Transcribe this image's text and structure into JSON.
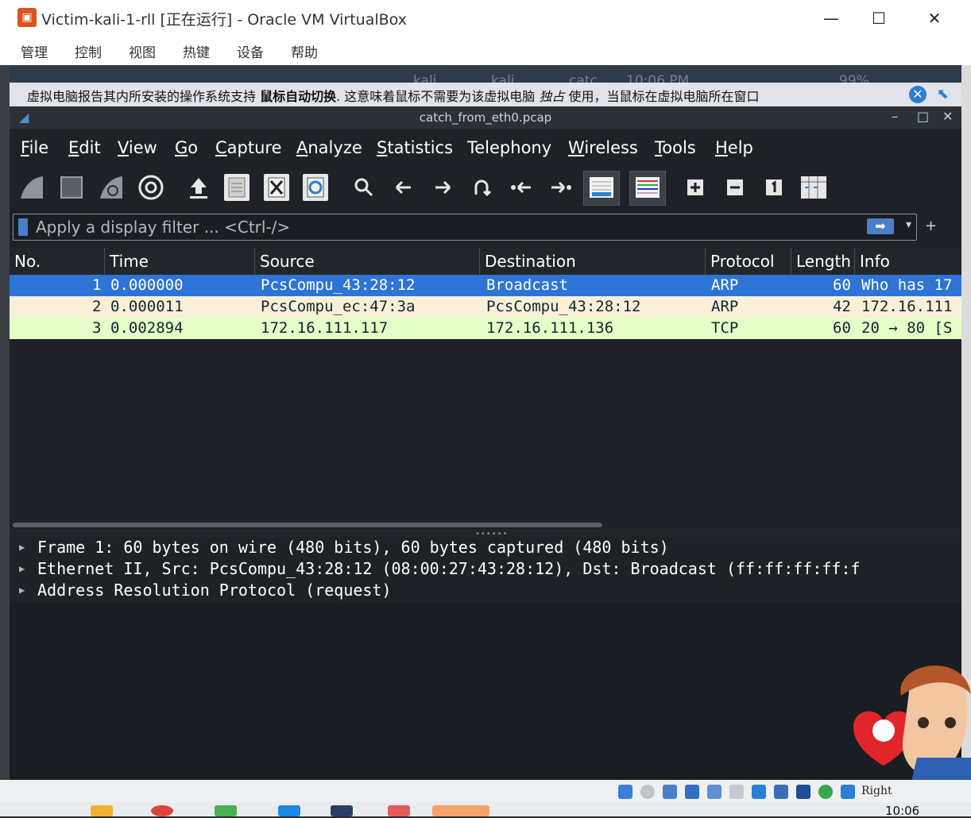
{
  "host_window": {
    "title": "Victim-kali-1-rll [正在运行] - Oracle VM VirtualBox",
    "minimize": "—",
    "maximize": "☐",
    "close": "✕"
  },
  "host_menu": [
    "管理",
    "控制",
    "视图",
    "热键",
    "设备",
    "帮助"
  ],
  "guest_panel": {
    "items": [
      "kali",
      "kali",
      "catc...",
      "10:06 PM",
      "99%"
    ]
  },
  "notice": {
    "text_before": "虚拟电脑报告其内所安装的操作系统支持",
    "bold": "鼠标自动切换",
    "text_mid": ". 这意味着鼠标不需要为该虚拟电脑",
    "italic": "独占",
    "text_after": "使用，当鼠标在虚拟电脑所在窗口"
  },
  "wireshark": {
    "title": "catch_from_eth0.pcap",
    "controls": [
      "–",
      "□",
      "✕"
    ],
    "menu": [
      {
        "u": "F",
        "rest": "ile"
      },
      {
        "u": "E",
        "rest": "dit"
      },
      {
        "u": "V",
        "rest": "iew"
      },
      {
        "u": "G",
        "rest": "o"
      },
      {
        "u": "C",
        "rest": "apture"
      },
      {
        "u": "A",
        "rest": "nalyze"
      },
      {
        "u": "S",
        "rest": "tatistics"
      },
      {
        "u": "",
        "rest": "Telephony"
      },
      {
        "u": "W",
        "rest": "ireless"
      },
      {
        "u": "T",
        "rest": "ools"
      },
      {
        "u": "H",
        "rest": "elp"
      }
    ],
    "filter": {
      "placeholder": "Apply a display filter ... <Ctrl-/>",
      "value": ""
    },
    "columns": [
      "No.",
      "Time",
      "Source",
      "Destination",
      "Protocol",
      "Length",
      "Info"
    ],
    "packets": [
      {
        "no": "1",
        "time": "0.000000",
        "source": "PcsCompu_43:28:12",
        "destination": "Broadcast",
        "protocol": "ARP",
        "length": "60",
        "info": "Who has 17"
      },
      {
        "no": "2",
        "time": "0.000011",
        "source": "PcsCompu_ec:47:3a",
        "destination": "PcsCompu_43:28:12",
        "protocol": "ARP",
        "length": "42",
        "info": "172.16.111"
      },
      {
        "no": "3",
        "time": "0.002894",
        "source": "172.16.111.117",
        "destination": "172.16.111.136",
        "protocol": "TCP",
        "length": "60",
        "info": "20 → 80 [S"
      }
    ],
    "details": [
      "Frame 1: 60 bytes on wire (480 bits), 60 bytes captured (480 bits)",
      "Ethernet II, Src: PcsCompu_43:28:12 (08:00:27:43:28:12), Dst: Broadcast (ff:ff:ff:ff:f",
      "Address Resolution Protocol (request)"
    ]
  },
  "host_status": {
    "right_key": "Right"
  },
  "taskbar": {
    "clock": "10:06"
  },
  "colors": {
    "selected_row": "#2e74d6",
    "arp_row": "#faf0d7",
    "tcp_row": "#e4ffc7",
    "accent": "#4a7fc9"
  }
}
